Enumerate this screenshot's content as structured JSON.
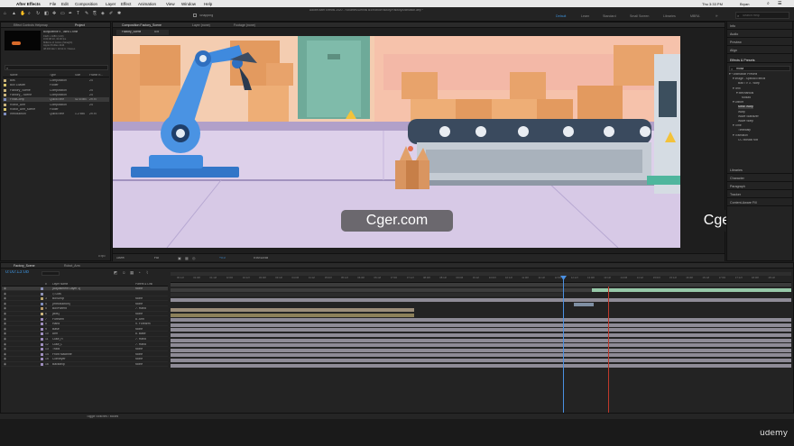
{
  "menu": {
    "apple": "",
    "app": "After Effects",
    "items": [
      "File",
      "Edit",
      "Composition",
      "Layer",
      "Effect",
      "Animation",
      "View",
      "Window",
      "Help"
    ],
    "window_title": "Adobe After Effects 2020 - /Volumes/Dennis B4/Robot/Factory/FactoryAnimation.aep *",
    "user": "Bryan",
    "clock": "Thu 3:33 PM"
  },
  "toolbar": {
    "snapping": "Snapping",
    "workspaces": [
      "Default",
      "Learn",
      "Standard",
      "Small Screen",
      "Libraries",
      "MBRA"
    ],
    "active_workspace": "Default",
    "search_placeholder": "Search Help"
  },
  "project": {
    "tabs": [
      "Effect Controls Helpmap",
      "Project"
    ],
    "preview_info": "Bonjulienne ▾ , used 1 time",
    "preview_meta": "1920 x 1080 (1.00)\n0:00:08:10, 30.00 fps\nMillions of Colors (Straight)\nApple ProRes 4444\n48.000 kHz / 32 bit U / Stereo",
    "search_placeholder": "",
    "columns": [
      "Name",
      "Type",
      "Size",
      "Frame R..."
    ],
    "items": [
      {
        "name": "Bits",
        "type": "Composition",
        "size": "",
        "fr": "24",
        "color": "#c9b37b"
      },
      {
        "name": "Box Loader",
        "type": "Folder",
        "size": "",
        "fr": "",
        "color": "#d6c36a"
      },
      {
        "name": "Factory_Scene",
        "type": "Composition",
        "size": "",
        "fr": "24",
        "color": "#c9b37b"
      },
      {
        "name": "Factory_..scene",
        "type": "Composition",
        "size": "",
        "fr": "24",
        "color": "#c9b37b"
      },
      {
        "name": "FinalComp",
        "type": "QuickTime",
        "size": "42.6 MB",
        "fr": "29.97",
        "color": "#7d8cbd"
      },
      {
        "name": "Robot_Arm",
        "type": "Composition",
        "size": "",
        "fr": "24",
        "color": "#c9b37b"
      },
      {
        "name": "Robot_Arm_scene",
        "type": "Folder",
        "size": "",
        "fr": "",
        "color": "#d6c36a"
      },
      {
        "name": "Introduction",
        "type": "QuickTime",
        "size": "1.2 MB",
        "fr": "29.97",
        "color": "#7d8cbd"
      }
    ],
    "footer": "8 bpc"
  },
  "viewer": {
    "tabs": [
      "Composition Factory_Scene",
      "Layer (none)",
      "Footage (none)"
    ],
    "sub_tabs": [
      "Factory_Scene",
      "Bits"
    ],
    "zoom": "100%",
    "resolution": "Full",
    "timecode": "0:00:13:08",
    "offset": "+0.0"
  },
  "watermarks": [
    "Cger.com",
    "Cger.com"
  ],
  "right_panel": {
    "sections": [
      "Info",
      "Audio",
      "Preview",
      "Align"
    ],
    "effects_title": "Effects & Presets",
    "effects_search": "mosa",
    "effects_tree": [
      "▾ * Animation Presets",
      "▾ Image - Special Effects",
      "Bad TV 3 - warp",
      "▾ Text",
      "▾ Mechanical",
      "Mosaic",
      "▾ Distort",
      "Mesh Warp",
      "Warp",
      "Wave Stabilizer",
      "Wave Warp",
      "▾ Time",
      "Timewarp",
      "▾ Transition",
      "CC Mosaic Mix"
    ],
    "lower_sections": [
      "Libraries",
      "Character",
      "Paragraph",
      "Tracker",
      "Content-Aware Fill"
    ]
  },
  "timeline": {
    "tabs": [
      "Factory_Scene",
      "Robot_Arm"
    ],
    "timecode": "0:00:13:08",
    "columns": [
      "#",
      "Layer Name",
      "Parent & Link"
    ],
    "layers": [
      {
        "num": "",
        "name": "[Adjustment Layer 1]",
        "parent": "None",
        "color": "#8a8fb5"
      },
      {
        "num": "",
        "name": "◇ Lids",
        "parent": "",
        "color": "#8a8fb5"
      },
      {
        "num": "3",
        "name": "BoxDrop",
        "parent": "None",
        "color": "#b8a56d"
      },
      {
        "num": "4",
        "name": "[Introduction]",
        "parent": "None",
        "color": "#7d8cbd"
      },
      {
        "num": "5",
        "name": "BoxParent",
        "parent": "7. Hand",
        "color": "#b89a6a"
      },
      {
        "num": "6",
        "name": "[Bits]",
        "parent": "None",
        "color": "#c9b37b"
      },
      {
        "num": "7",
        "name": "Forearm",
        "parent": "8. Arm",
        "color": "#9d8cbd"
      },
      {
        "num": "8",
        "name": "Hand",
        "parent": "9. Forearm",
        "color": "#9d8cbd"
      },
      {
        "num": "9",
        "name": "Base",
        "parent": "None",
        "color": "#9d8cbd"
      },
      {
        "num": "10",
        "name": "Arm",
        "parent": "8. Base",
        "color": "#9d8cbd"
      },
      {
        "num": "11",
        "name": "Claw_R",
        "parent": "7. Hand",
        "color": "#9d8cbd"
      },
      {
        "num": "12",
        "name": "Claw_L",
        "parent": "7. Hand",
        "color": "#9d8cbd"
      },
      {
        "num": "13",
        "name": "Track",
        "parent": "None",
        "color": "#9d8cbd"
      },
      {
        "num": "14",
        "name": "Front Machine",
        "parent": "None",
        "color": "#9d8cbd"
      },
      {
        "num": "15",
        "name": "Conveyer",
        "parent": "None",
        "color": "#9d8cbd"
      },
      {
        "num": "16",
        "name": "Backdrop",
        "parent": "None",
        "color": "#9d8cbd"
      }
    ],
    "ruler": [
      "00:12f",
      "01:00f",
      "01:12f",
      "02:00f",
      "02:12f",
      "03:00f",
      "03:12f",
      "04:00f",
      "04:12f",
      "05:00f",
      "05:12f",
      "06:00f",
      "06:12f",
      "07:00f",
      "07:12f",
      "08:00f",
      "08:12f",
      "09:00f",
      "09:12f",
      "10:00f",
      "10:12f",
      "11:00f",
      "11:12f",
      "12:00f",
      "12:12f",
      "13:00f",
      "13:12f",
      "14:00f",
      "14:12f",
      "15:00f",
      "15:12f",
      "16:00f",
      "16:12f",
      "17:00f",
      "17:12f",
      "18:00f",
      "18:12f"
    ],
    "footer": "Toggle Switches / Modes"
  },
  "brand": "ûdemy",
  "colors": {
    "accent": "#3d8fd6",
    "playhead": "#4a90e2",
    "work_area": "#c0392b",
    "layer_bar": "#8e8b96",
    "adj_bar": "#96c8a8"
  }
}
